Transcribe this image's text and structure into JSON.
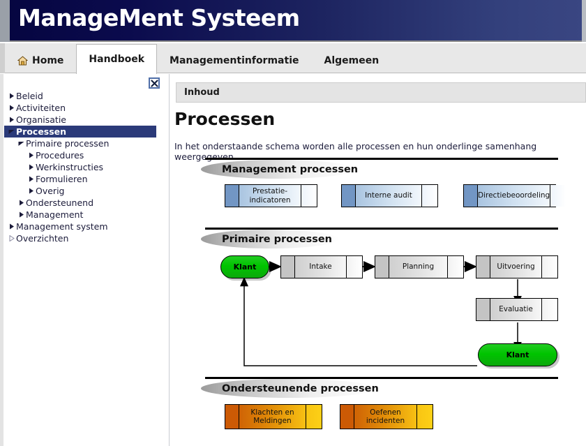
{
  "header": {
    "title": "ManageMent Systeem"
  },
  "tabs": [
    {
      "label": "Home",
      "icon": "home-icon",
      "active": false
    },
    {
      "label": "Handboek",
      "icon": null,
      "active": true
    },
    {
      "label": "Managementinformatie",
      "icon": null,
      "active": false
    },
    {
      "label": "Algemeen",
      "icon": null,
      "active": false
    }
  ],
  "sidebar": {
    "close_label": "close-icon",
    "items": [
      {
        "label": "Beleid",
        "level": 0,
        "arrow": "right",
        "selected": false
      },
      {
        "label": "Activiteiten",
        "level": 0,
        "arrow": "right",
        "selected": false
      },
      {
        "label": "Organisatie",
        "level": 0,
        "arrow": "right",
        "selected": false
      },
      {
        "label": "Processen",
        "level": 0,
        "arrow": "down",
        "selected": true
      },
      {
        "label": "Primaire processen",
        "level": 1,
        "arrow": "down",
        "selected": false
      },
      {
        "label": "Procedures",
        "level": 2,
        "arrow": "right",
        "selected": false
      },
      {
        "label": "Werkinstructies",
        "level": 2,
        "arrow": "right",
        "selected": false
      },
      {
        "label": "Formulieren",
        "level": 2,
        "arrow": "right",
        "selected": false
      },
      {
        "label": "Overig",
        "level": 2,
        "arrow": "right",
        "selected": false
      },
      {
        "label": "Ondersteunend",
        "level": 1,
        "arrow": "right",
        "selected": false
      },
      {
        "label": "Management",
        "level": 1,
        "arrow": "right",
        "selected": false
      },
      {
        "label": "Management system",
        "level": 0,
        "arrow": "right",
        "selected": false
      },
      {
        "label": "Overzichten",
        "level": 0,
        "arrow": "righthollow",
        "selected": false
      }
    ]
  },
  "content": {
    "inhoud_label": "Inhoud",
    "page_title": "Processen",
    "intro": "In het onderstaande schema worden alle processen en hun onderlinge samenhang weergegeven."
  },
  "diagram": {
    "sections": [
      {
        "title": "Management processen"
      },
      {
        "title": "Primaire processen"
      },
      {
        "title": "Ondersteunende processen"
      }
    ],
    "management_boxes": [
      {
        "label": "Prestatie-indicatoren"
      },
      {
        "label": "Interne audit"
      },
      {
        "label": "Directiebeoordeling"
      }
    ],
    "primary_flow": [
      {
        "label": "Klant",
        "type": "terminator"
      },
      {
        "label": "Intake",
        "type": "process"
      },
      {
        "label": "Planning",
        "type": "process"
      },
      {
        "label": "Uitvoering",
        "type": "process"
      },
      {
        "label": "Evaluatie",
        "type": "process"
      },
      {
        "label": "Klant",
        "type": "terminator"
      }
    ],
    "supporting_boxes": [
      {
        "label": "Klachten en",
        "label2": "Meldingen"
      },
      {
        "label": "Oefenen incidenten",
        "label2": ""
      }
    ]
  },
  "colors": {
    "title_bar_left": "#050540",
    "title_bar_right": "#3a4682",
    "selection": "#2b3a79",
    "management_accent": "#7296c4",
    "primary_accent": "#c4c4c4",
    "supporting_accent": "#cc5a05",
    "terminator_green": "#00c400"
  }
}
